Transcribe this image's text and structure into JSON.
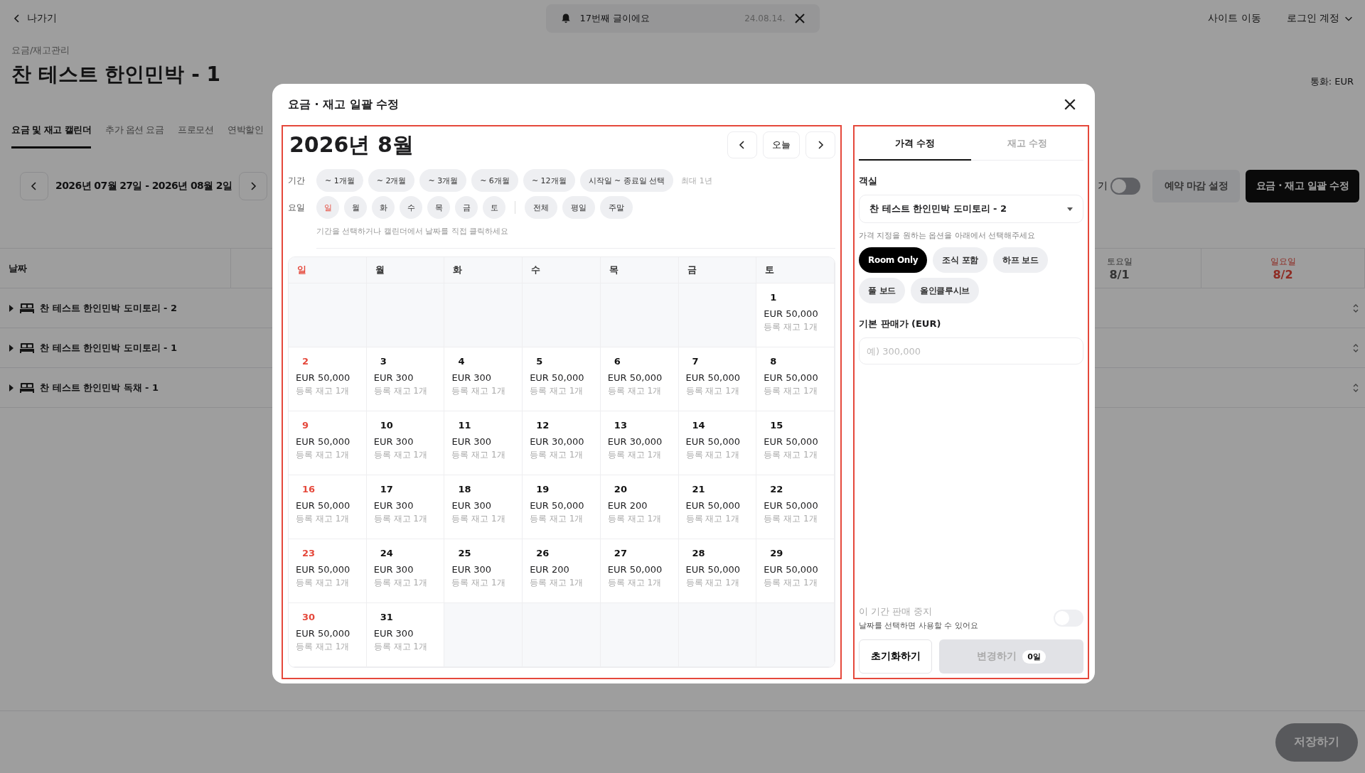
{
  "top_bar": {
    "back": "나가기",
    "notification": {
      "text": "17번째 글이에요",
      "date": "24.08.14."
    },
    "site_link": "사이트 이동",
    "account": "로그인 계정"
  },
  "page": {
    "breadcrumb": "요금/재고관리",
    "title": "찬 테스트 한인민박 - 1",
    "currency": "통화: EUR"
  },
  "tabs": [
    {
      "label": "요금 및 재고 캘린더",
      "selected": true
    },
    {
      "label": "추가 옵션 요금",
      "selected": false
    },
    {
      "label": "프로모션",
      "selected": false
    },
    {
      "label": "연박할인",
      "selected": false
    }
  ],
  "date_range": "2026년 07월 27일 - 2026년 08월 2일",
  "toggle": {
    "label": "기",
    "on": false
  },
  "actions": [
    {
      "label": "예약 마감 설정",
      "kind": "secondary"
    },
    {
      "label": "요금 · 재고 일괄 수정",
      "kind": "primary"
    }
  ],
  "table": {
    "first_column": "날짜",
    "days": [
      {
        "weekday": "토요일",
        "date": "8/1",
        "sunday": false
      },
      {
        "weekday": "일요일",
        "date": "8/2",
        "sunday": true
      }
    ],
    "rows": [
      "찬 테스트 한인민박 도미토리 - 2",
      "찬 테스트 한인민박 도미토리 - 1",
      "찬 테스트 한인민박 독채 - 1"
    ]
  },
  "save_button": "저장하기",
  "modal": {
    "title": "요금 · 재고 일괄 수정",
    "calendar": {
      "month": "2026년 8월",
      "today": "오늘",
      "period_label": "기간",
      "periods": [
        "~ 1개월",
        "~ 2개월",
        "~ 3개월",
        "~ 6개월",
        "~ 12개월",
        "시작일 ~ 종료일 선택"
      ],
      "period_note": "최대 1년",
      "weekday_label": "요일",
      "weekdays": [
        "일",
        "월",
        "화",
        "수",
        "목",
        "금",
        "토"
      ],
      "groups": [
        "전체",
        "평일",
        "주말"
      ],
      "hint": "기간을 선택하거나 캘린더에서 날짜를 직접 클릭하세요",
      "columns": [
        "일",
        "월",
        "화",
        "수",
        "목",
        "금",
        "토"
      ],
      "weeks": [
        [
          {
            "kind": "blank"
          },
          {
            "kind": "blank"
          },
          {
            "kind": "blank"
          },
          {
            "kind": "blank"
          },
          {
            "kind": "blank"
          },
          {
            "kind": "blank"
          },
          {
            "kind": "day",
            "day": "1",
            "price": "EUR 50,000",
            "stock": "등록 재고 1개"
          }
        ],
        [
          {
            "kind": "day",
            "day": "2",
            "price": "EUR 50,000",
            "stock": "등록 재고 1개"
          },
          {
            "kind": "day",
            "day": "3",
            "price": "EUR 300",
            "stock": "등록 재고 1개"
          },
          {
            "kind": "day",
            "day": "4",
            "price": "EUR 300",
            "stock": "등록 재고 1개"
          },
          {
            "kind": "day",
            "day": "5",
            "price": "EUR 50,000",
            "stock": "등록 재고 1개"
          },
          {
            "kind": "day",
            "day": "6",
            "price": "EUR 50,000",
            "stock": "등록 재고 1개"
          },
          {
            "kind": "day",
            "day": "7",
            "price": "EUR 50,000",
            "stock": "등록 재고 1개"
          },
          {
            "kind": "day",
            "day": "8",
            "price": "EUR 50,000",
            "stock": "등록 재고 1개"
          }
        ],
        [
          {
            "kind": "day",
            "day": "9",
            "price": "EUR 50,000",
            "stock": "등록 재고 1개"
          },
          {
            "kind": "day",
            "day": "10",
            "price": "EUR 300",
            "stock": "등록 재고 1개"
          },
          {
            "kind": "day",
            "day": "11",
            "price": "EUR 300",
            "stock": "등록 재고 1개"
          },
          {
            "kind": "day",
            "day": "12",
            "price": "EUR 30,000",
            "stock": "등록 재고 1개"
          },
          {
            "kind": "day",
            "day": "13",
            "price": "EUR 30,000",
            "stock": "등록 재고 1개"
          },
          {
            "kind": "day",
            "day": "14",
            "price": "EUR 50,000",
            "stock": "등록 재고 1개"
          },
          {
            "kind": "day",
            "day": "15",
            "price": "EUR 50,000",
            "stock": "등록 재고 1개"
          }
        ],
        [
          {
            "kind": "day",
            "day": "16",
            "price": "EUR 50,000",
            "stock": "등록 재고 1개"
          },
          {
            "kind": "day",
            "day": "17",
            "price": "EUR 300",
            "stock": "등록 재고 1개"
          },
          {
            "kind": "day",
            "day": "18",
            "price": "EUR 300",
            "stock": "등록 재고 1개"
          },
          {
            "kind": "day",
            "day": "19",
            "price": "EUR 50,000",
            "stock": "등록 재고 1개"
          },
          {
            "kind": "day",
            "day": "20",
            "price": "EUR 200",
            "stock": "등록 재고 1개"
          },
          {
            "kind": "day",
            "day": "21",
            "price": "EUR 50,000",
            "stock": "등록 재고 1개"
          },
          {
            "kind": "day",
            "day": "22",
            "price": "EUR 50,000",
            "stock": "등록 재고 1개"
          }
        ],
        [
          {
            "kind": "day",
            "day": "23",
            "price": "EUR 50,000",
            "stock": "등록 재고 1개"
          },
          {
            "kind": "day",
            "day": "24",
            "price": "EUR 300",
            "stock": "등록 재고 1개"
          },
          {
            "kind": "day",
            "day": "25",
            "price": "EUR 300",
            "stock": "등록 재고 1개"
          },
          {
            "kind": "day",
            "day": "26",
            "price": "EUR 200",
            "stock": "등록 재고 1개"
          },
          {
            "kind": "day",
            "day": "27",
            "price": "EUR 50,000",
            "stock": "등록 재고 1개"
          },
          {
            "kind": "day",
            "day": "28",
            "price": "EUR 50,000",
            "stock": "등록 재고 1개"
          },
          {
            "kind": "day",
            "day": "29",
            "price": "EUR 50,000",
            "stock": "등록 재고 1개"
          }
        ],
        [
          {
            "kind": "day",
            "day": "30",
            "price": "EUR 50,000",
            "stock": "등록 재고 1개"
          },
          {
            "kind": "day",
            "day": "31",
            "price": "EUR 300",
            "stock": "등록 재고 1개"
          },
          {
            "kind": "blank"
          },
          {
            "kind": "blank"
          },
          {
            "kind": "blank"
          },
          {
            "kind": "blank"
          },
          {
            "kind": "blank"
          }
        ]
      ]
    },
    "panel": {
      "tabs": [
        {
          "label": "가격 수정",
          "selected": true
        },
        {
          "label": "재고 수정",
          "selected": false
        }
      ],
      "room_label": "객실",
      "room_value": "찬 테스트 한인민박 도미토리 - 2",
      "option_hint": "가격 지정을 원하는 옵션을 아래에서 선택해주세요",
      "options": [
        {
          "label": "Room Only",
          "selected": true
        },
        {
          "label": "조식 포함",
          "selected": false
        },
        {
          "label": "하프 보드",
          "selected": false
        },
        {
          "label": "풀 보드",
          "selected": false
        },
        {
          "label": "올인클루시브",
          "selected": false
        }
      ],
      "price_label": "기본 판매가 (EUR)",
      "price_placeholder": "예) 300,000",
      "stop_sale": {
        "title": "이 기간 판매 중지",
        "note": "날짜를 선택하면 사용할 수 있어요",
        "on": false,
        "disabled": true
      },
      "reset": "초기화하기",
      "apply": {
        "label": "변경하기",
        "count": "0일",
        "disabled": true
      }
    }
  }
}
